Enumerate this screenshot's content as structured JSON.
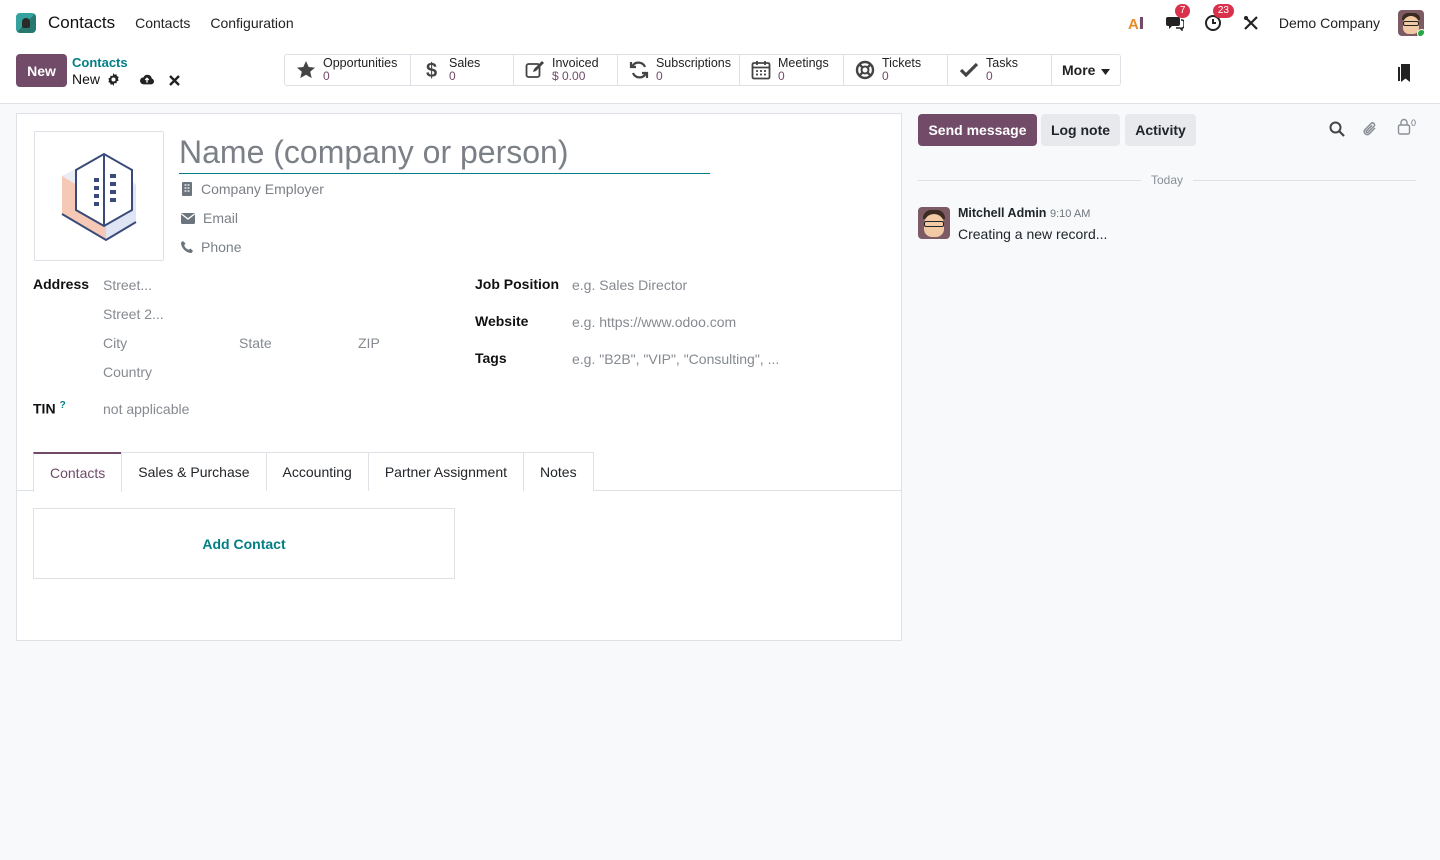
{
  "navbar": {
    "app_name": "Contacts",
    "menu": [
      "Contacts",
      "Configuration"
    ],
    "ai_label": "AI",
    "messages_count": "7",
    "activities_count": "23",
    "company": "Demo Company"
  },
  "control": {
    "new_label": "New",
    "breadcrumb_parent": "Contacts",
    "breadcrumb_current": "New",
    "stats": [
      {
        "label": "Opportunities",
        "value": "0",
        "icon": "star-icon"
      },
      {
        "label": "Sales",
        "value": "0",
        "icon": "dollar-icon"
      },
      {
        "label": "Invoiced",
        "value": "$ 0.00",
        "icon": "edit-icon"
      },
      {
        "label": "Subscriptions",
        "value": "0",
        "icon": "refresh-icon"
      },
      {
        "label": "Meetings",
        "value": "0",
        "icon": "calendar-icon"
      },
      {
        "label": "Tickets",
        "value": "0",
        "icon": "lifebuoy-icon"
      },
      {
        "label": "Tasks",
        "value": "0",
        "icon": "check-icon"
      }
    ],
    "more_label": "More"
  },
  "form": {
    "name_placeholder": "Name (company or person)",
    "company_placeholder": "Company Employer",
    "email_placeholder": "Email",
    "phone_placeholder": "Phone",
    "address_label": "Address",
    "street_placeholder": "Street...",
    "street2_placeholder": "Street 2...",
    "city_placeholder": "City",
    "state_placeholder": "State",
    "zip_placeholder": "ZIP",
    "country_placeholder": "Country",
    "tin_label": "TIN",
    "tin_help": "?",
    "tin_placeholder": "not applicable",
    "job_label": "Job Position",
    "job_placeholder": "e.g. Sales Director",
    "website_label": "Website",
    "website_placeholder": "e.g. https://www.odoo.com",
    "tags_label": "Tags",
    "tags_placeholder": "e.g. \"B2B\", \"VIP\", \"Consulting\", ..."
  },
  "tabs": [
    "Contacts",
    "Sales & Purchase",
    "Accounting",
    "Partner Assignment",
    "Notes"
  ],
  "add_contact_label": "Add Contact",
  "chatter": {
    "send_message": "Send message",
    "log_note": "Log note",
    "activity": "Activity",
    "followers_count": "0",
    "today": "Today",
    "message": {
      "author": "Mitchell Admin",
      "time": "9:10 AM",
      "body": "Creating a new record..."
    }
  },
  "colors": {
    "primary": "#714b67",
    "link": "#017e84",
    "badge": "#d9314b"
  }
}
